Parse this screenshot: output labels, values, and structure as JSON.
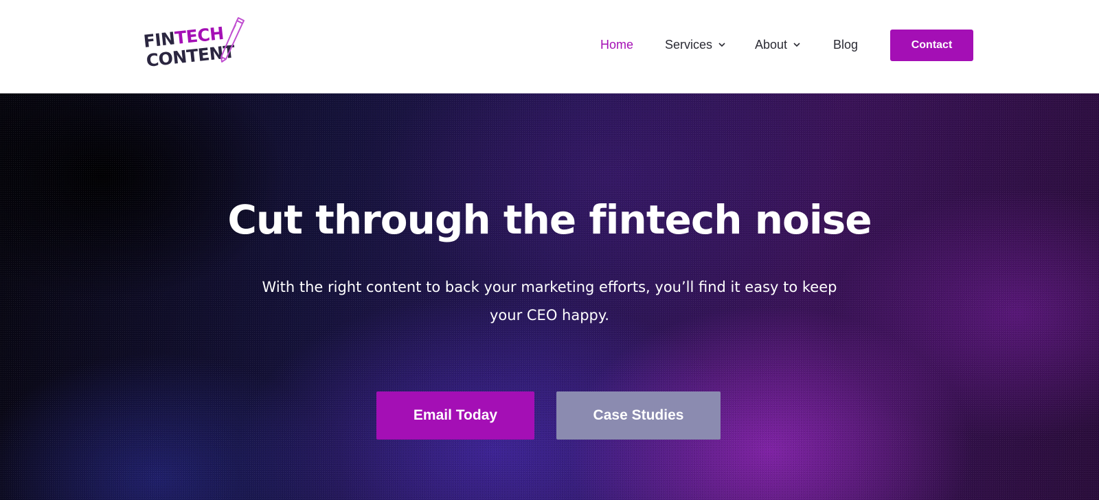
{
  "logo": {
    "line1_dark": "FIN",
    "line1_accent": "TECH",
    "line2": "CONTENT",
    "icon": "pen-icon"
  },
  "nav": {
    "items": [
      {
        "label": "Home",
        "active": true
      },
      {
        "label": "Services",
        "has_dropdown": true
      },
      {
        "label": "About",
        "has_dropdown": true
      },
      {
        "label": "Blog"
      }
    ],
    "contact_label": "Contact"
  },
  "hero": {
    "title": "Cut through the fintech noise",
    "subtitle": "With the right content to back your marketing efforts, you’ll find it easy to keep your CEO happy.",
    "primary_button": "Email Today",
    "secondary_button": "Case Studies"
  },
  "colors": {
    "accent": "#a40fb5",
    "secondary_button": "#8b8bb0",
    "nav_text": "#2a2a33",
    "logo_dark": "#2b2640"
  }
}
